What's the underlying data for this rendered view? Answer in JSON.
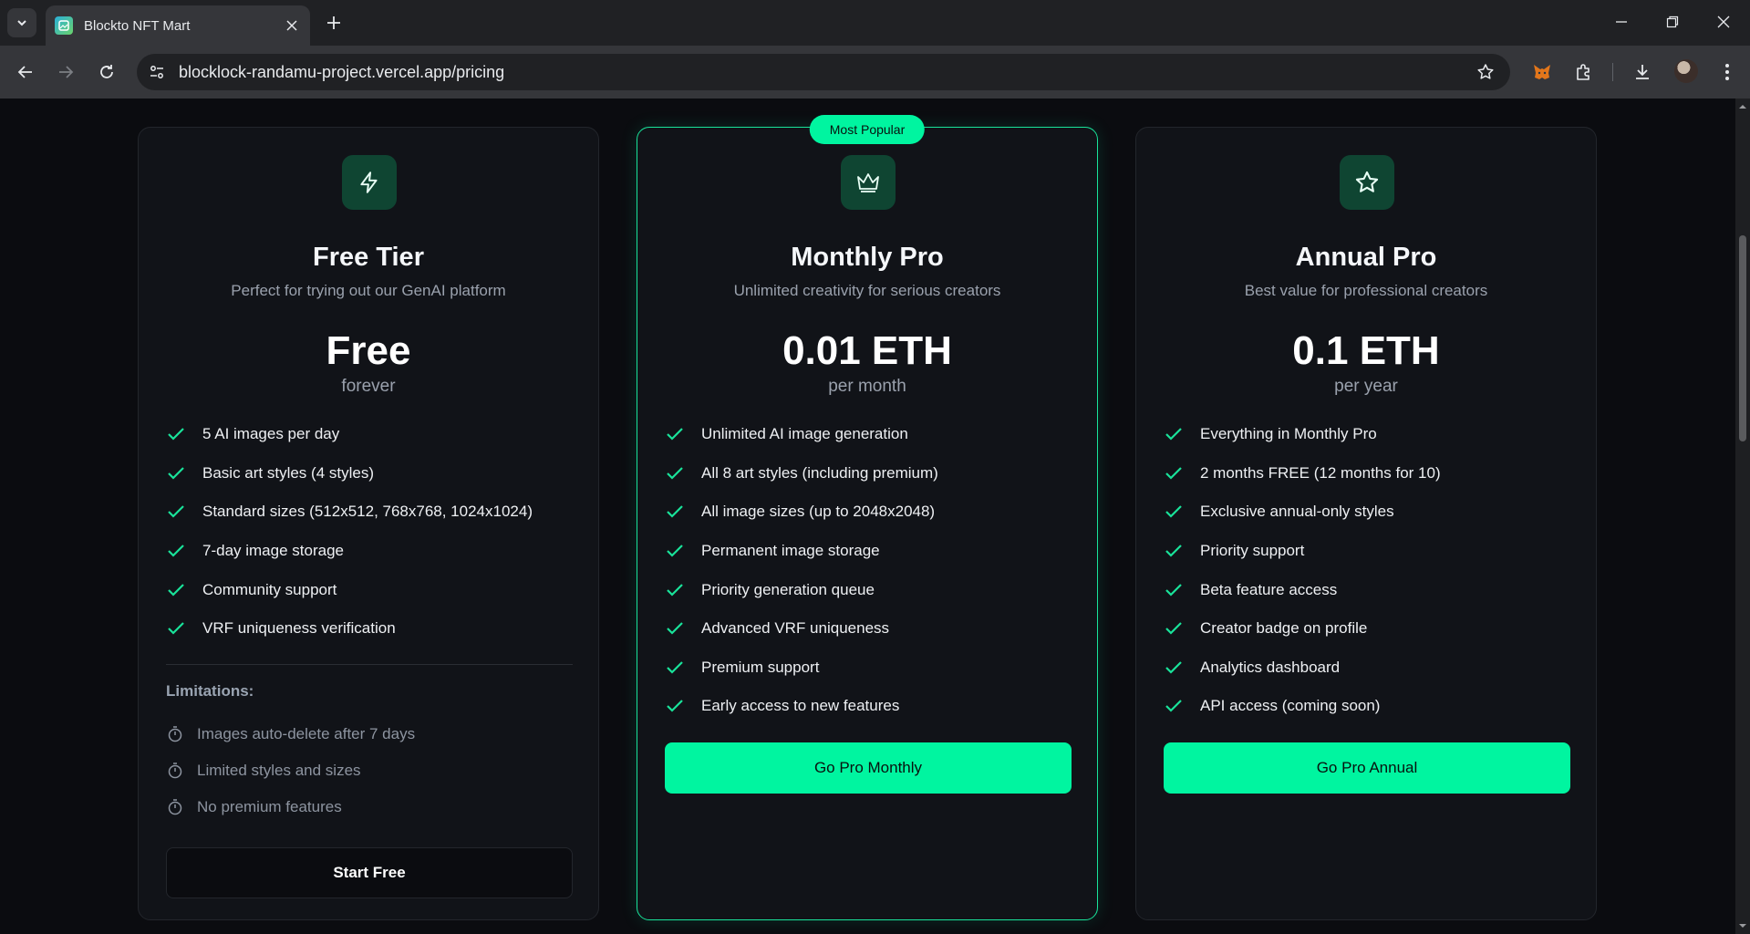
{
  "browser": {
    "tab_title": "Blockto NFT Mart",
    "url": "blocklock-randamu-project.vercel.app/pricing"
  },
  "plans": [
    {
      "icon": "lightning-icon",
      "name": "Free Tier",
      "description": "Perfect for trying out our GenAI platform",
      "price": "Free",
      "period": "forever",
      "features": [
        "5 AI images per day",
        "Basic art styles (4 styles)",
        "Standard sizes (512x512, 768x768, 1024x1024)",
        "7-day image storage",
        "Community support",
        "VRF uniqueness verification"
      ],
      "limitations_title": "Limitations:",
      "limitations": [
        "Images auto-delete after 7 days",
        "Limited styles and sizes",
        "No premium features"
      ],
      "button": "Start Free"
    },
    {
      "icon": "crown-icon",
      "badge": "Most Popular",
      "name": "Monthly Pro",
      "description": "Unlimited creativity for serious creators",
      "price": "0.01 ETH",
      "period": "per month",
      "features": [
        "Unlimited AI image generation",
        "All 8 art styles (including premium)",
        "All image sizes (up to 2048x2048)",
        "Permanent image storage",
        "Priority generation queue",
        "Advanced VRF uniqueness",
        "Premium support",
        "Early access to new features"
      ],
      "button": "Go Pro Monthly"
    },
    {
      "icon": "star-icon",
      "name": "Annual Pro",
      "description": "Best value for professional creators",
      "price": "0.1 ETH",
      "period": "per year",
      "features": [
        "Everything in Monthly Pro",
        "2 months FREE (12 months for 10)",
        "Exclusive annual-only styles",
        "Priority support",
        "Beta feature access",
        "Creator badge on profile",
        "Analytics dashboard",
        "API access (coming soon)"
      ],
      "button": "Go Pro Annual"
    }
  ],
  "colors": {
    "accent": "#00f5a0",
    "background": "#0b0c10",
    "card": "#111318",
    "icon_bg": "#0f4532"
  }
}
